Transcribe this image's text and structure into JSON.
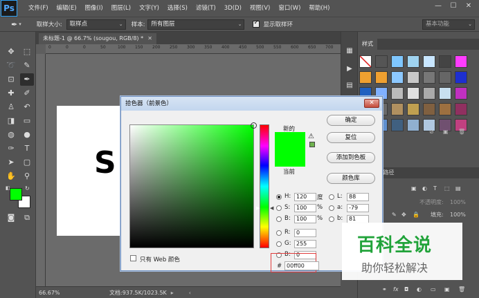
{
  "app": {
    "logo": "Ps"
  },
  "menu": [
    "文件(F)",
    "编辑(E)",
    "图像(I)",
    "图层(L)",
    "文字(Y)",
    "选择(S)",
    "滤镜(T)",
    "3D(D)",
    "视图(V)",
    "窗口(W)",
    "帮助(H)"
  ],
  "window_controls": {
    "minimize": "—",
    "maximize": "☐",
    "close": "✕"
  },
  "options": {
    "sample_size_label": "取样大小:",
    "sample_size_value": "取样点",
    "sample_label": "样本:",
    "sample_value": "所有图层",
    "show_ring_label": "显示取样环",
    "workspace": "基本功能"
  },
  "document": {
    "tab_title": "未标题-1 @ 66.7% (sougou, RGB/8) *",
    "canvas_text": "S"
  },
  "ruler_marks": [
    "0",
    "0",
    "0",
    "50",
    "100",
    "150",
    "200",
    "250",
    "300",
    "350",
    "400",
    "450",
    "500",
    "550",
    "600",
    "650",
    "700"
  ],
  "status": {
    "zoom": "66.67%",
    "doc_size": "文档:937.5K/1023.5K"
  },
  "panels": {
    "styles_tab": "样式",
    "channels_tab": "通道",
    "paths_tab": "路径",
    "opacity_label": "不透明度:",
    "opacity_value": "100%",
    "fill_label": "填充:",
    "fill_value": "100%"
  },
  "color_picker": {
    "title": "拾色器（前景色）",
    "new_label": "新的",
    "current_label": "当前",
    "buttons": {
      "ok": "确定",
      "reset": "复位",
      "add_to_swatches": "添加到色板",
      "color_libraries": "颜色库"
    },
    "hsb": {
      "h_label": "H:",
      "h_value": "120",
      "h_unit": "度",
      "s_label": "S:",
      "s_value": "100",
      "s_unit": "%",
      "b_label": "B:",
      "b_value": "100",
      "b_unit": "%"
    },
    "lab": {
      "l_label": "L:",
      "l_value": "88",
      "a_label": "a:",
      "a_value": "-79",
      "b_label": "b:",
      "b_value": "81"
    },
    "rgb": {
      "r_label": "R:",
      "r_value": "0",
      "g_label": "G:",
      "g_value": "255",
      "b_label": "B:",
      "b_value": "0"
    },
    "hex_label": "#",
    "hex_value": "00ff00",
    "web_only_label": "只有 Web 颜色",
    "new_color": "#00ff00",
    "current_color": "#00ff00",
    "hue_degrees": 120
  },
  "foreground_color": "#00ff00",
  "background_color": "#ffffff",
  "watermark": {
    "title": "百科全说",
    "subtitle": "助你轻松解决"
  }
}
